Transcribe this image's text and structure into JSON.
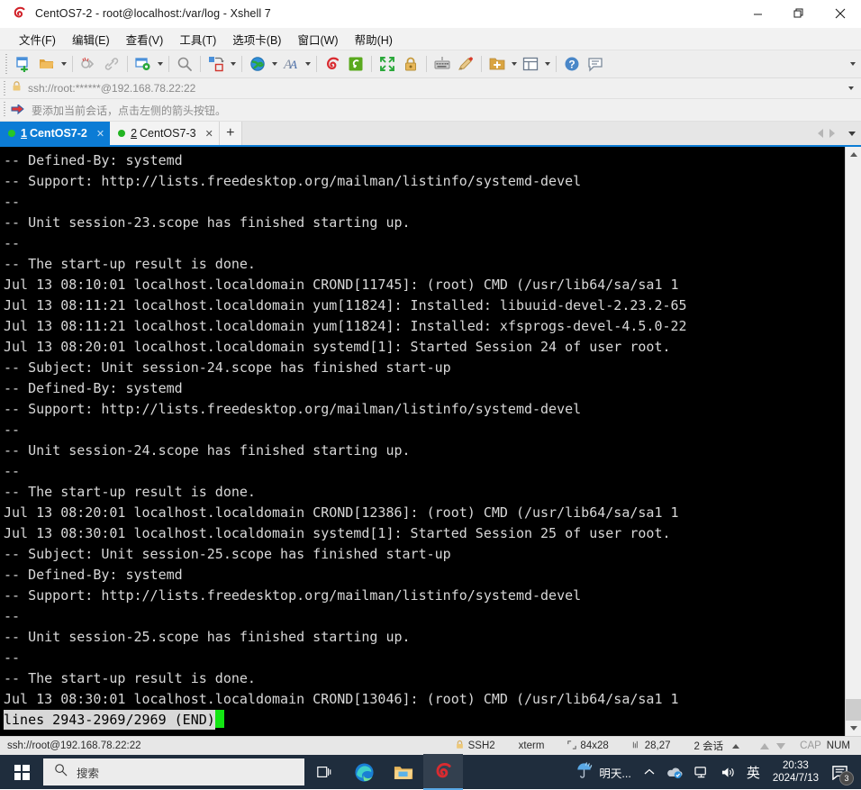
{
  "window": {
    "title": "CentOS7-2 - root@localhost:/var/log - Xshell 7",
    "app_icon": "xshell-spiral-icon",
    "controls": {
      "minimize": "—",
      "restore": "❐",
      "close": "✕"
    }
  },
  "menubar": {
    "items": [
      {
        "label": "文件(F)",
        "name": "menu-file"
      },
      {
        "label": "编辑(E)",
        "name": "menu-edit"
      },
      {
        "label": "查看(V)",
        "name": "menu-view"
      },
      {
        "label": "工具(T)",
        "name": "menu-tools"
      },
      {
        "label": "选项卡(B)",
        "name": "menu-tabs"
      },
      {
        "label": "窗口(W)",
        "name": "menu-window"
      },
      {
        "label": "帮助(H)",
        "name": "menu-help"
      }
    ]
  },
  "toolbar": {
    "icons": [
      "new-session-icon",
      "open-folder-icon",
      "disconnect-icon",
      "link-icon",
      "session-properties-icon",
      "find-icon",
      "transfer-icon",
      "globe-icon",
      "font-icon",
      "xshell-icon",
      "xftp-icon",
      "fullscreen-icon",
      "lock-icon",
      "keyboard-icon",
      "highlight-pen-icon",
      "new-folder-icon",
      "layout-icon",
      "help-icon",
      "comment-icon"
    ],
    "overflow": "toolbar-overflow-caret"
  },
  "address_bar": {
    "value": "ssh://root:******@192.168.78.22:22",
    "lock_icon": "lock-icon",
    "caret": "address-overflow-caret"
  },
  "hint_bar": {
    "text": "要添加当前会话，点击左侧的箭头按钮。",
    "icon": "red-arrow-icon"
  },
  "tabs": {
    "items": [
      {
        "num": "1",
        "name": "CentOS7-2",
        "active": true,
        "status": "connected"
      },
      {
        "num": "2",
        "name": "CentOS7-3",
        "active": false,
        "status": "connected"
      }
    ],
    "add_label": "+",
    "nav": {
      "prev": "tab-prev-arrow",
      "next": "tab-next-arrow",
      "list": "tab-list-caret"
    }
  },
  "terminal": {
    "lines": [
      "-- Defined-By: systemd",
      "-- Support: http://lists.freedesktop.org/mailman/listinfo/systemd-devel",
      "--",
      "-- Unit session-23.scope has finished starting up.",
      "--",
      "-- The start-up result is done.",
      "Jul 13 08:10:01 localhost.localdomain CROND[11745]: (root) CMD (/usr/lib64/sa/sa1 1",
      "Jul 13 08:11:21 localhost.localdomain yum[11824]: Installed: libuuid-devel-2.23.2-65",
      "Jul 13 08:11:21 localhost.localdomain yum[11824]: Installed: xfsprogs-devel-4.5.0-22",
      "Jul 13 08:20:01 localhost.localdomain systemd[1]: Started Session 24 of user root.",
      "-- Subject: Unit session-24.scope has finished start-up",
      "-- Defined-By: systemd",
      "-- Support: http://lists.freedesktop.org/mailman/listinfo/systemd-devel",
      "--",
      "-- Unit session-24.scope has finished starting up.",
      "--",
      "-- The start-up result is done.",
      "Jul 13 08:20:01 localhost.localdomain CROND[12386]: (root) CMD (/usr/lib64/sa/sa1 1",
      "Jul 13 08:30:01 localhost.localdomain systemd[1]: Started Session 25 of user root.",
      "-- Subject: Unit session-25.scope has finished start-up",
      "-- Defined-By: systemd",
      "-- Support: http://lists.freedesktop.org/mailman/listinfo/systemd-devel",
      "--",
      "-- Unit session-25.scope has finished starting up.",
      "--",
      "-- The start-up result is done.",
      "Jul 13 08:30:01 localhost.localdomain CROND[13046]: (root) CMD (/usr/lib64/sa/sa1 1"
    ],
    "status_line": "lines 2943-2969/2969 (END)",
    "cursor": "block-cursor"
  },
  "status_bar": {
    "connection": "ssh://root@192.168.78.22:22",
    "protocol": "SSH2",
    "terminal_type": "xterm",
    "size": "84x28",
    "cursor_pos": "28,27",
    "sessions": "2 会话",
    "cap": "CAP",
    "num": "NUM"
  },
  "taskbar": {
    "start": "windows-start-icon",
    "search_placeholder": "搜索",
    "task_view": "task-view-icon",
    "apps": [
      {
        "name": "edge-icon"
      },
      {
        "name": "file-explorer-icon"
      },
      {
        "name": "xshell-icon",
        "active": true
      }
    ],
    "weather": "明天...",
    "tray": [
      "chevron-up-icon",
      "onedrive-icon",
      "network-icon",
      "volume-icon"
    ],
    "ime": "英",
    "time": "20:33",
    "date": "2024/7/13",
    "notification_count": "3"
  }
}
